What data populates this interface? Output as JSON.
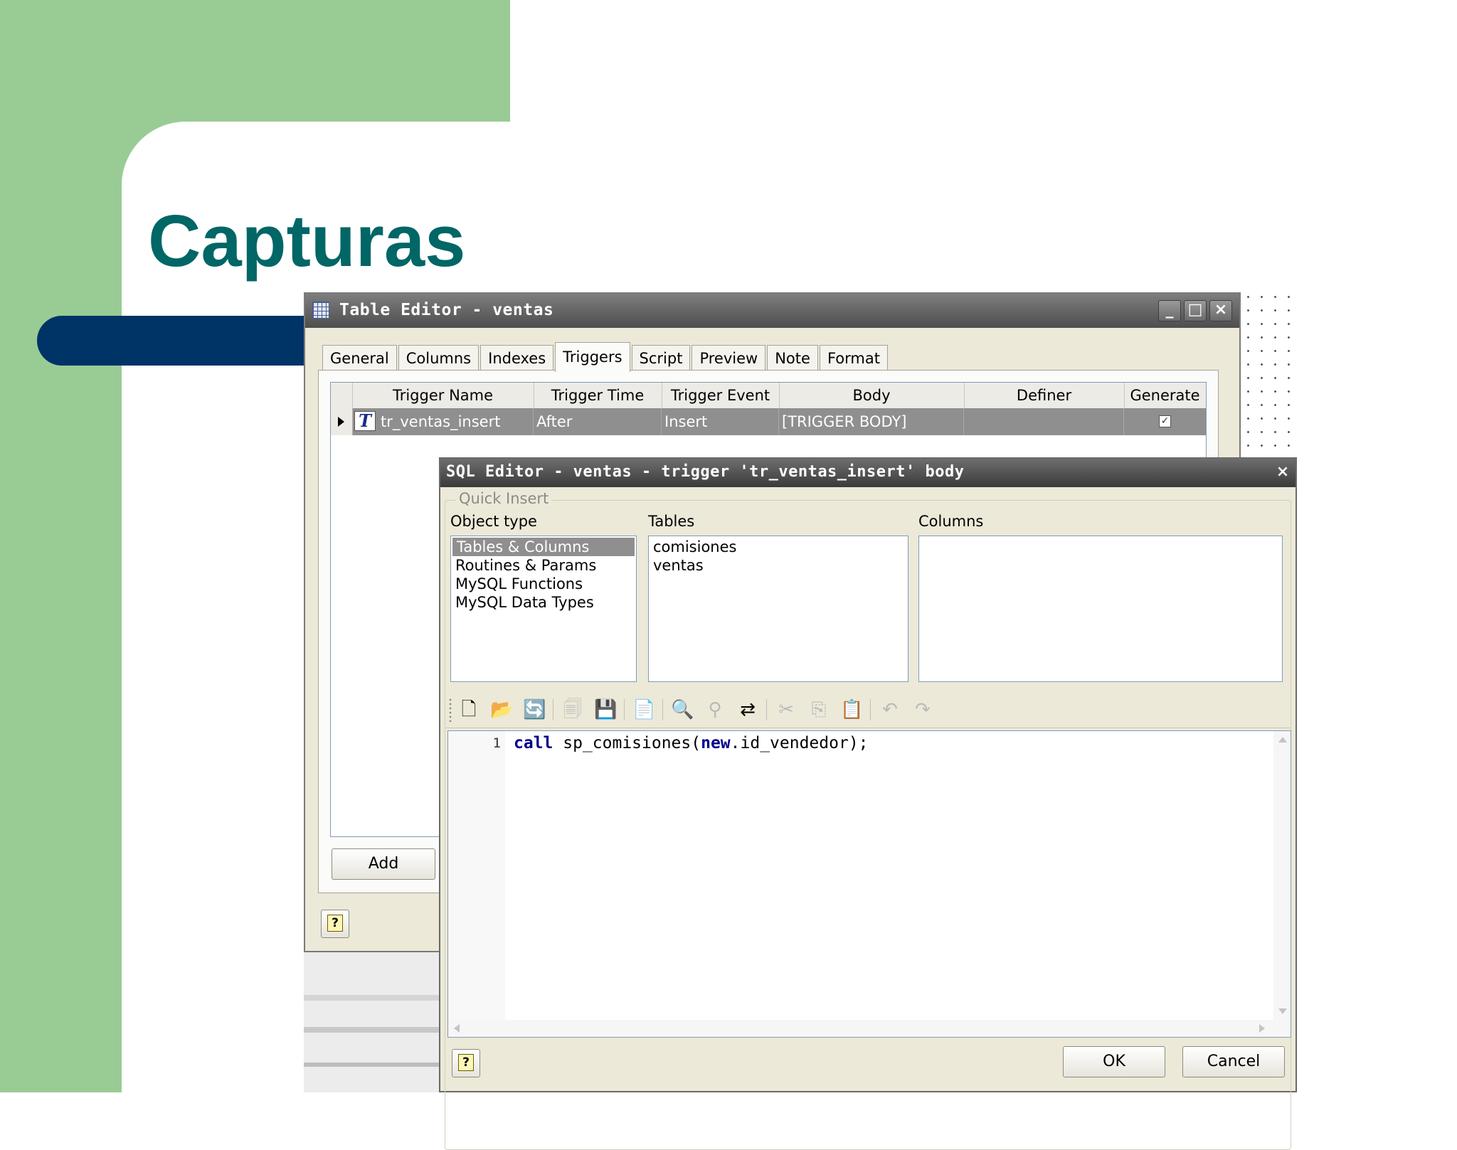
{
  "slide": {
    "title": "Capturas"
  },
  "table_editor": {
    "title": "Table Editor - ventas",
    "window_buttons": {
      "minimize": "_",
      "maximize": "□",
      "close": "×"
    },
    "tabs": [
      {
        "label": "General"
      },
      {
        "label": "Columns"
      },
      {
        "label": "Indexes"
      },
      {
        "label": "Triggers",
        "active": true
      },
      {
        "label": "Script"
      },
      {
        "label": "Preview"
      },
      {
        "label": "Note"
      },
      {
        "label": "Format"
      }
    ],
    "columns": [
      "Trigger Name",
      "Trigger Time",
      "Trigger Event",
      "Body",
      "Definer",
      "Generate"
    ],
    "row_icon": "T",
    "rows": [
      {
        "trigger_name": "tr_ventas_insert",
        "trigger_time": "After",
        "trigger_event": "Insert",
        "body": "[TRIGGER BODY]",
        "definer": "",
        "generate": "✓"
      }
    ],
    "add_button": "Add",
    "help_button": "?"
  },
  "sql_editor": {
    "title": "SQL Editor - ventas - trigger 'tr_ventas_insert' body",
    "close_button": "×",
    "quick_insert": {
      "legend": "Quick Insert",
      "object_type_label": "Object type",
      "object_types": [
        "Tables & Columns",
        "Routines & Params",
        "MySQL Functions",
        "MySQL Data Types"
      ],
      "selected_object_type": 0,
      "tables_label": "Tables",
      "tables": [
        "comisiones",
        "ventas"
      ],
      "columns_label": "Columns"
    },
    "toolbar_icons": [
      {
        "name": "new-document-icon",
        "glyph": "🗋",
        "enabled": true
      },
      {
        "name": "open-file-icon",
        "glyph": "📂",
        "enabled": true
      },
      {
        "name": "reload-icon",
        "glyph": "🔄",
        "enabled": true
      },
      {
        "name": "save-disabled-icon",
        "glyph": "🗐",
        "enabled": false
      },
      {
        "name": "save-icon",
        "glyph": "💾",
        "enabled": true
      },
      {
        "name": "document-list-icon",
        "glyph": "📄",
        "enabled": true
      },
      {
        "name": "find-icon",
        "glyph": "🔍",
        "enabled": true
      },
      {
        "name": "find-next-icon",
        "glyph": "⚲",
        "enabled": false
      },
      {
        "name": "replace-icon",
        "glyph": "⇄",
        "enabled": true
      },
      {
        "name": "cut-icon",
        "glyph": "✂",
        "enabled": false
      },
      {
        "name": "copy-icon",
        "glyph": "⎘",
        "enabled": false
      },
      {
        "name": "paste-icon",
        "glyph": "📋",
        "enabled": false
      },
      {
        "name": "undo-icon",
        "glyph": "↶",
        "enabled": false
      },
      {
        "name": "redo-icon",
        "glyph": "↷",
        "enabled": false
      }
    ],
    "code": {
      "line_number": "1",
      "tokens": [
        {
          "text": "call",
          "keyword": true
        },
        {
          "text": " sp_comisiones(",
          "keyword": false
        },
        {
          "text": "new",
          "keyword": true
        },
        {
          "text": ".id_vendedor);",
          "keyword": false
        }
      ]
    },
    "ok_button": "OK",
    "cancel_button": "Cancel",
    "help_button": "?"
  }
}
